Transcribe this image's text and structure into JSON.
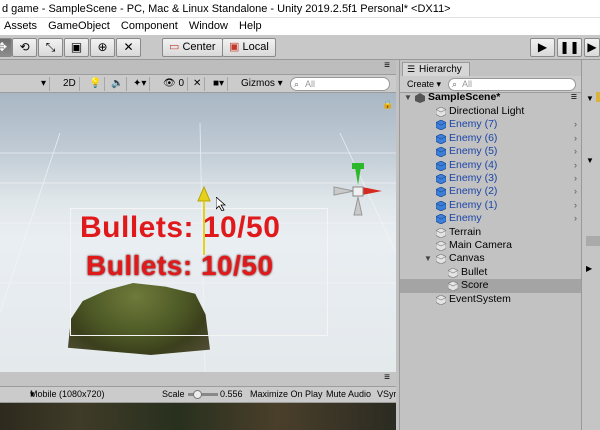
{
  "window": {
    "title": "d game - SampleScene - PC, Mac & Linux Standalone - Unity 2019.2.5f1 Personal* <DX11>"
  },
  "menu": [
    "Assets",
    "GameObject",
    "Component",
    "Window",
    "Help"
  ],
  "toolbar": {
    "tools": [
      "move-tool",
      "rotate-tool",
      "scale-tool",
      "rect-tool",
      "transform-tool"
    ],
    "pivot_label": "Center",
    "space_label": "Local"
  },
  "scene": {
    "mode_label": "2D",
    "gizmos_label": "Gizmos",
    "search_placeholder": "All",
    "fx_count": "0",
    "texts": [
      "Bullets: 10/50",
      "Bullets: 10/50"
    ]
  },
  "game": {
    "resolution": "Mobile (1080x720)",
    "scale_label": "Scale",
    "scale_value": "0.556",
    "maximize_label": "Maximize On Play",
    "mute_label": "Mute Audio",
    "stats_label": "VSyr"
  },
  "hierarchy": {
    "tab_label": "Hierarchy",
    "create_label": "Create",
    "search_placeholder": "All",
    "scene_name": "SampleScene*",
    "items": [
      {
        "label": "Directional Light",
        "depth": 1,
        "prefab": false,
        "arrow": false
      },
      {
        "label": "Enemy (7)",
        "depth": 1,
        "prefab": true,
        "arrow": true
      },
      {
        "label": "Enemy (6)",
        "depth": 1,
        "prefab": true,
        "arrow": true
      },
      {
        "label": "Enemy (5)",
        "depth": 1,
        "prefab": true,
        "arrow": true
      },
      {
        "label": "Enemy (4)",
        "depth": 1,
        "prefab": true,
        "arrow": true
      },
      {
        "label": "Enemy (3)",
        "depth": 1,
        "prefab": true,
        "arrow": true
      },
      {
        "label": "Enemy (2)",
        "depth": 1,
        "prefab": true,
        "arrow": true
      },
      {
        "label": "Enemy (1)",
        "depth": 1,
        "prefab": true,
        "arrow": true
      },
      {
        "label": "Enemy",
        "depth": 1,
        "prefab": true,
        "arrow": true
      },
      {
        "label": "Terrain",
        "depth": 1,
        "prefab": false,
        "arrow": false
      },
      {
        "label": "Main Camera",
        "depth": 1,
        "prefab": false,
        "arrow": false
      },
      {
        "label": "Canvas",
        "depth": 1,
        "prefab": false,
        "arrow": false,
        "expanded": true
      },
      {
        "label": "Bullet",
        "depth": 2,
        "prefab": false,
        "arrow": false
      },
      {
        "label": "Score",
        "depth": 2,
        "prefab": false,
        "arrow": false,
        "selected": true
      },
      {
        "label": "EventSystem",
        "depth": 1,
        "prefab": false,
        "arrow": false
      }
    ]
  },
  "colors": {
    "text_red": "#e0191b",
    "prefab_blue": "#1b45a6",
    "selection": "#a4a4a4"
  }
}
